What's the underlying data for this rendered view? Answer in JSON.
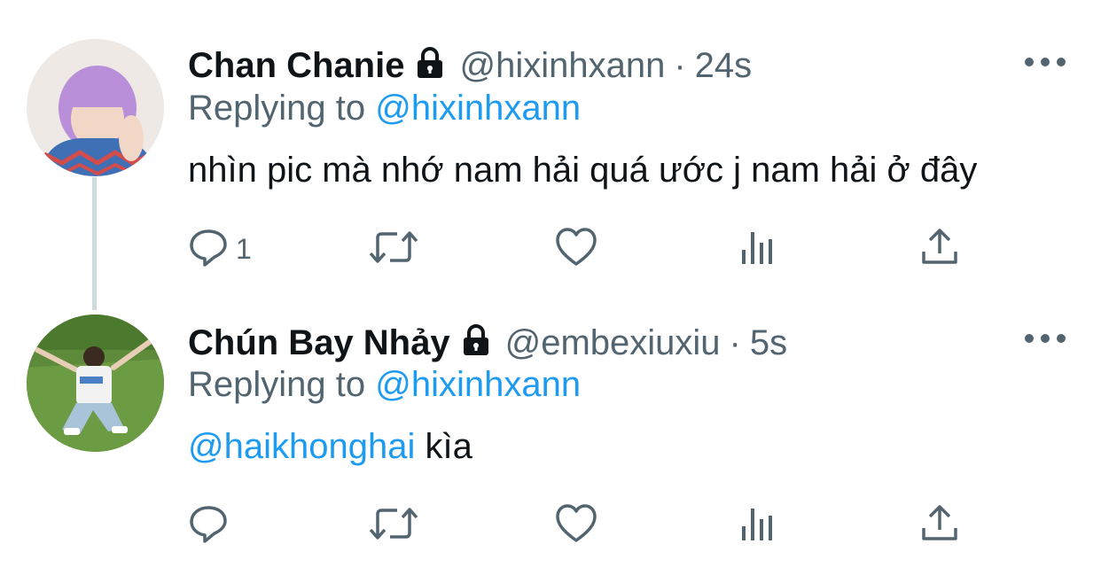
{
  "tweets": [
    {
      "name": "Chan Chanie",
      "handle": "@hixinhxann",
      "dot": "·",
      "time": "24s",
      "replying_prefix": "Replying to",
      "replying_to": "@hixinhxann",
      "text": "nhìn pic mà nhớ nam hải quá ước j nam hải ở đây",
      "reply_count": "1",
      "avatar": "purple-hair-person"
    },
    {
      "name": "Chún Bay Nhảy",
      "handle": "@embexiuxiu",
      "dot": "·",
      "time": "5s",
      "replying_prefix": "Replying to",
      "replying_to": "@hixinhxann",
      "mention": "@haikhonghai",
      "text_after": " kìa",
      "reply_count": "",
      "avatar": "person-on-grass"
    }
  ],
  "icons": {
    "lock": "lock-icon",
    "more": "more-icon",
    "reply": "reply-icon",
    "retweet": "retweet-icon",
    "like": "like-icon",
    "views": "views-icon",
    "share": "share-icon"
  },
  "colors": {
    "text": "#0f1419",
    "secondary": "#536471",
    "accent": "#1d9bf0",
    "thread_line": "#cfd9de"
  }
}
